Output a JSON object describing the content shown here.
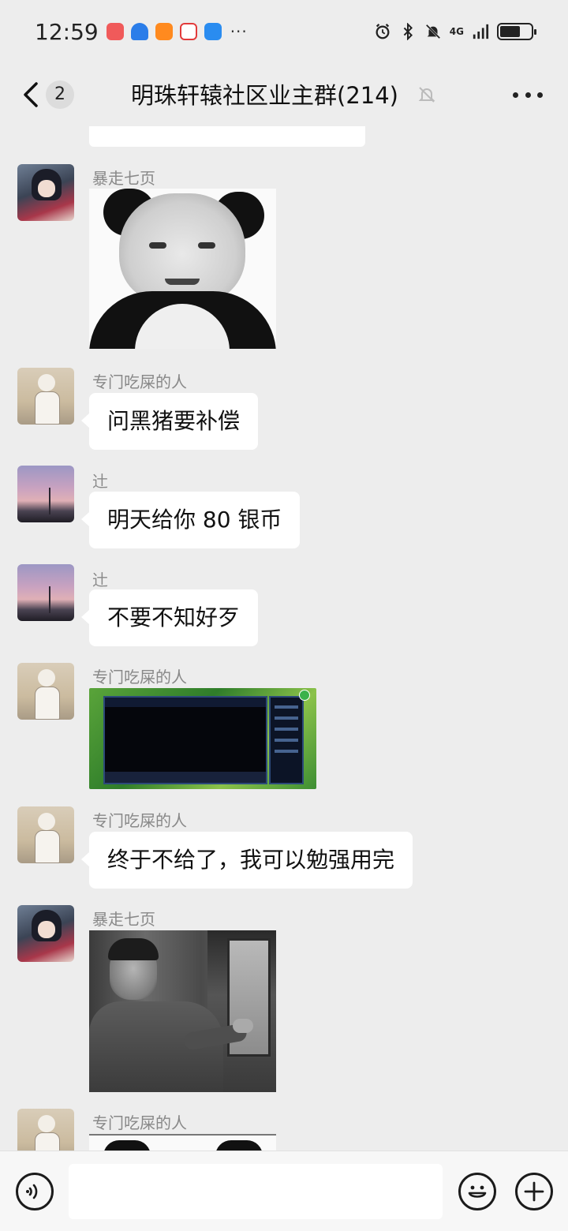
{
  "status_bar": {
    "time": "12:59",
    "notification_icons": [
      "mail-app-icon",
      "shield-app-icon",
      "video-app-icon",
      "calendar-app-icon",
      "weather-app-icon"
    ],
    "more": "···",
    "network_label": "4G",
    "battery_percent": 65
  },
  "header": {
    "unread_count": "2",
    "title": "明珠轩辕社区业主群(214)"
  },
  "messages": [
    {
      "sender": "暴走七页",
      "type": "image",
      "image": "panda-meme",
      "avatar": "anime-girl-avatar"
    },
    {
      "sender": "专门吃屎的人",
      "type": "text",
      "text": "问黑猪要补偿",
      "avatar": "child-photo-avatar"
    },
    {
      "sender": "辻",
      "type": "text",
      "text": "明天给你 80 银币",
      "avatar": "sunset-avatar"
    },
    {
      "sender": "辻",
      "type": "text",
      "text": "不要不知好歹",
      "avatar": "sunset-avatar"
    },
    {
      "sender": "专门吃屎的人",
      "type": "image",
      "image": "game-chat-screenshot",
      "avatar": "child-photo-avatar"
    },
    {
      "sender": "专门吃屎的人",
      "type": "text",
      "text": "终于不给了，我可以勉强用完",
      "avatar": "child-photo-avatar"
    },
    {
      "sender": "暴走七页",
      "type": "image",
      "image": "man-pointing-meme",
      "avatar": "anime-girl-avatar"
    },
    {
      "sender": "专门吃屎的人",
      "type": "image",
      "image": "panda-meme-partial",
      "avatar": "child-photo-avatar"
    }
  ],
  "input": {
    "value": "",
    "placeholder": ""
  },
  "colors": {
    "background": "#ededed",
    "bubble": "#ffffff",
    "sender_text": "#888888"
  }
}
